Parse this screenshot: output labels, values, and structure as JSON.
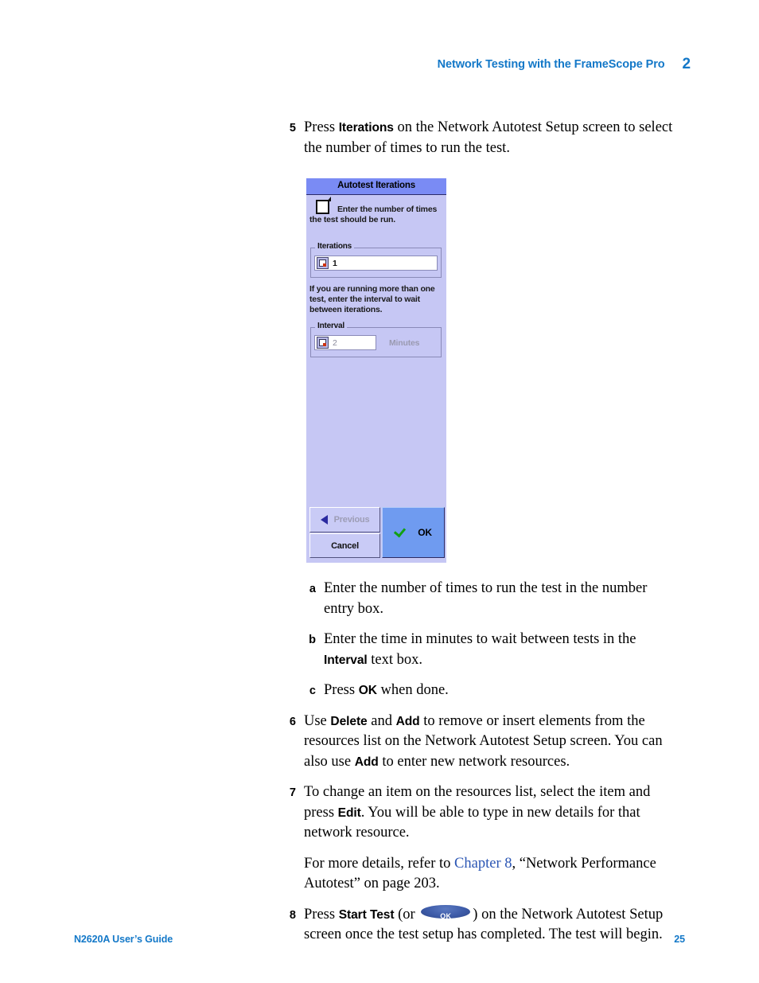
{
  "header": {
    "title": "Network Testing with the FrameScope Pro",
    "chapter_number": "2"
  },
  "footer": {
    "guide": "N2620A User’s Guide",
    "page_number": "25"
  },
  "colors": {
    "accent_blue": "#1378c8",
    "xref_blue": "#2b56b4",
    "dialog_body": "#c6c7f4",
    "dialog_titlebar": "#7a8bf4",
    "ok_button": "#6f9bf0",
    "check_green": "#12a012"
  },
  "steps": {
    "step5": {
      "num": "5",
      "text_a": "Press ",
      "bold_a": "Iterations",
      "text_b": " on the Network Autotest Setup screen to select the number of times to run the test."
    },
    "sub_a": {
      "num": "a",
      "text": "Enter the number of times to run the test in the number entry box."
    },
    "sub_b": {
      "num": "b",
      "text_a": "Enter the time in minutes to wait between tests in the ",
      "bold_a": "Interval",
      "text_b": " text box."
    },
    "sub_c": {
      "num": "c",
      "text_a": "Press ",
      "bold_a": "OK",
      "text_b": " when done."
    },
    "step6": {
      "num": "6",
      "text_a": "Use ",
      "bold_a": "Delete",
      "text_b": " and ",
      "bold_b": "Add",
      "text_c": " to remove or insert elements from the resources list on the Network Autotest Setup screen. You can also use ",
      "bold_c": "Add",
      "text_d": " to enter new network resources."
    },
    "step7": {
      "num": "7",
      "text_a": "To change an item on the resources list, select the item and press ",
      "bold_a": "Edit",
      "text_b": ". You will be able to type in new details for that network resource."
    },
    "note": {
      "text_a": "For more details, refer to ",
      "xref": "Chapter 8",
      "text_b": ", “Network Performance Autotest” on page 203."
    },
    "step8": {
      "num": "8",
      "text_a": "Press ",
      "bold_a": "Start Test",
      "text_b": " (or ",
      "inline_button": "OK",
      "text_c": ") on the Network Autotest Setup screen once the test setup has completed. The test will begin."
    }
  },
  "dialog": {
    "title": "Autotest Iterations",
    "instruction": "Enter the number of times the test should be run.",
    "iterations_group": {
      "legend": "Iterations",
      "value": "1"
    },
    "interval_note": "If you are running more than one test, enter the interval to wait between iterations.",
    "interval_group": {
      "legend": "Interval",
      "value": "2",
      "unit": "Minutes"
    },
    "buttons": {
      "previous": "Previous",
      "cancel": "Cancel",
      "ok": "OK"
    }
  }
}
